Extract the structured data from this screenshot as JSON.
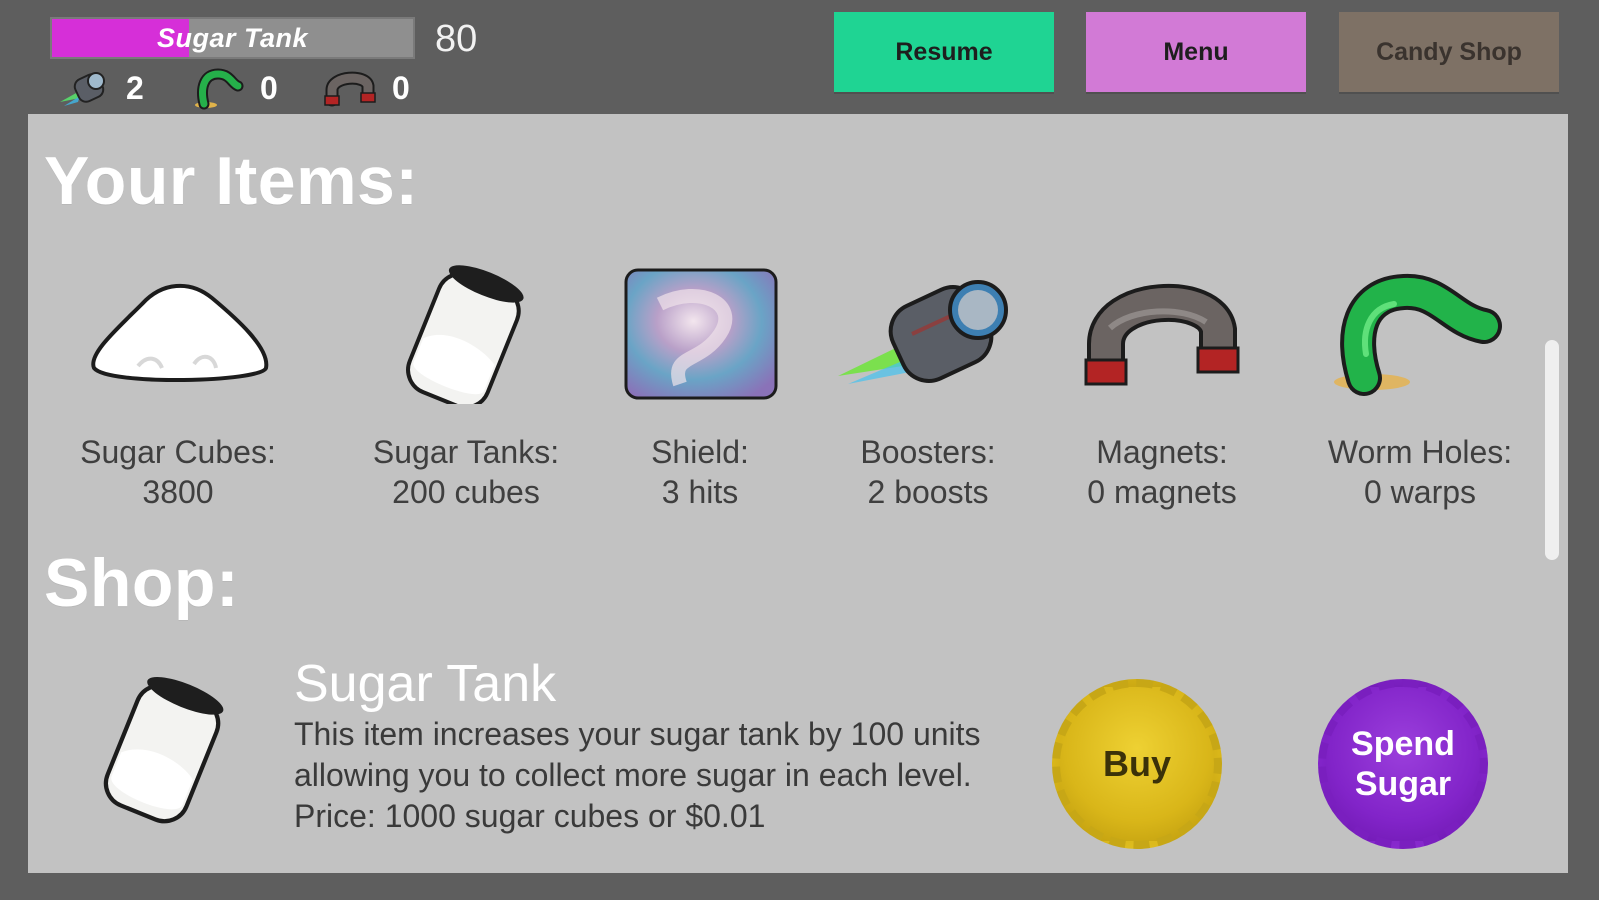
{
  "hud": {
    "sugar_tank": {
      "label": "Sugar Tank",
      "value": "80",
      "fill_fraction": 0.38
    },
    "counters": [
      {
        "icon": "booster-icon",
        "value": "2"
      },
      {
        "icon": "worm-hole-icon",
        "value": "0"
      },
      {
        "icon": "magnet-icon",
        "value": "0"
      }
    ],
    "buttons": {
      "resume": "Resume",
      "menu": "Menu",
      "candy_shop": "Candy Shop"
    }
  },
  "items_section": {
    "title": "Your Items:",
    "items": [
      {
        "icon": "sugar-pile-icon",
        "label": "Sugar Cubes:",
        "value": "3800"
      },
      {
        "icon": "sugar-jar-icon",
        "label": "Sugar Tanks:",
        "value": "200 cubes"
      },
      {
        "icon": "shield-icon",
        "label": "Shield:",
        "value": "3 hits"
      },
      {
        "icon": "booster-icon",
        "label": "Boosters:",
        "value": "2 boosts"
      },
      {
        "icon": "magnet-icon",
        "label": "Magnets:",
        "value": "0 magnets"
      },
      {
        "icon": "worm-hole-icon",
        "label": "Worm Holes:",
        "value": "0 warps"
      }
    ]
  },
  "shop_section": {
    "title": "Shop:",
    "product": {
      "icon": "sugar-jar-icon",
      "name": "Sugar Tank",
      "description": "This item increases your sugar tank by 100 units allowing you to collect more sugar in each level. Price: 1000 sugar cubes or $0.01",
      "buy_label": "Buy",
      "spend_label": "Spend Sugar"
    }
  },
  "colors": {
    "background": "#5e5e5e",
    "panel": "#c2c2c2",
    "tank_fill": "#d62fd8",
    "resume": "#1fd493",
    "menu": "#d27ad6",
    "candy_shop": "#7e7165",
    "buy": "#d9b619",
    "spend": "#8224c9"
  }
}
